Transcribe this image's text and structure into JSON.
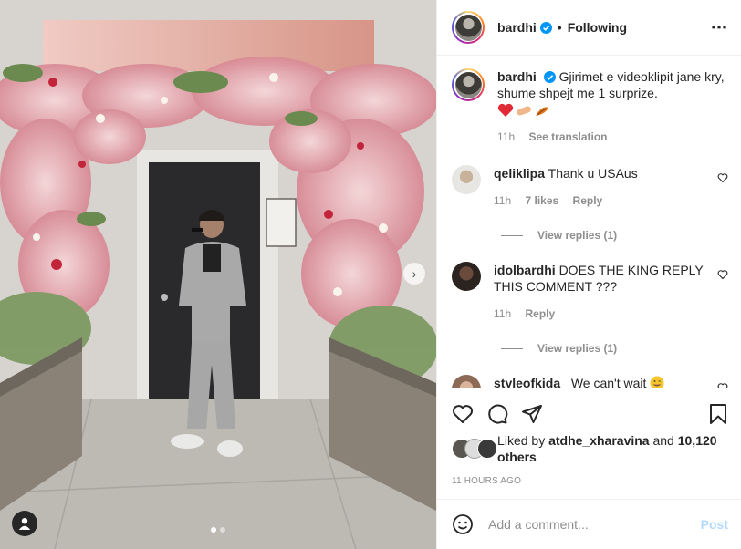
{
  "header": {
    "username": "bardhi",
    "separator": "•",
    "follow_status": "Following",
    "more_icon": "more-horizontal-icon"
  },
  "caption": {
    "username": "bardhi",
    "text": "Gjirimet e videoklipit jane kry, shume shpejt me 1 surprize.",
    "emojis": [
      "red-heart",
      "bandage",
      "hand-with-leaf"
    ],
    "time": "11h",
    "see_translation": "See translation"
  },
  "comments": [
    {
      "username": "qeliklipa",
      "text": "Thank u USAus",
      "time": "11h",
      "likes": "7 likes",
      "reply": "Reply",
      "view_replies": "View replies (1)"
    },
    {
      "username": "idolbardhi",
      "text": "DOES THE KING REPLY THIS COMMENT ???",
      "time": "11h",
      "likes": "",
      "reply": "Reply",
      "view_replies": "View replies (1)"
    },
    {
      "username": "styleofkida_",
      "text": "We can't wait",
      "emoji": "winking-tongue-face"
    }
  ],
  "likes": {
    "prefix": "Liked by",
    "user": "atdhe_xharavina",
    "conjunction": "and",
    "others": "10,120 others"
  },
  "timestamp": "11 HOURS AGO",
  "add_comment": {
    "placeholder": "Add a comment...",
    "post_label": "Post"
  },
  "colors": {
    "border": "#efefef",
    "secondary_text": "#8e8e8e",
    "post_button_disabled": "#b3dbff",
    "verified": "#0095f6"
  },
  "carousel": {
    "slide_count": 2,
    "active_index": 0
  }
}
